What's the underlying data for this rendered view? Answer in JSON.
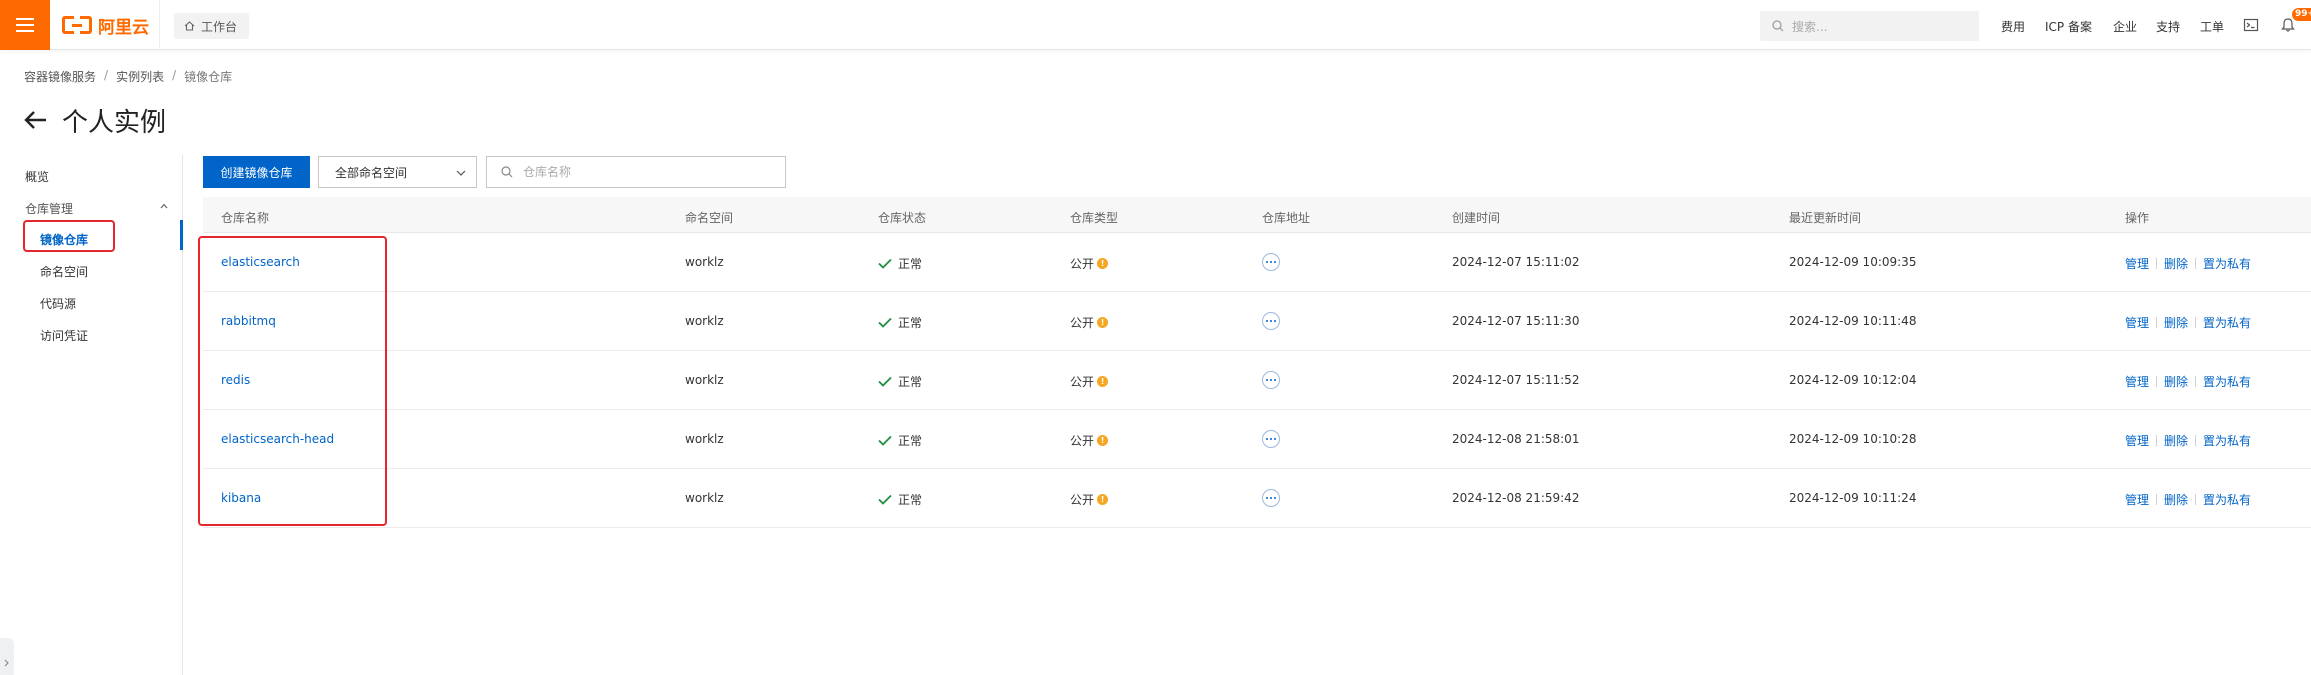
{
  "header": {
    "logo_text": "阿里云",
    "workbench_label": "工作台",
    "search_placeholder": "搜索...",
    "nav": [
      "费用",
      "ICP 备案",
      "企业",
      "支持",
      "工单"
    ],
    "notification_count": "99+",
    "brand_color": "#ff6a00"
  },
  "breadcrumb": [
    "容器镜像服务",
    "实例列表",
    "镜像仓库"
  ],
  "page_title": "个人实例",
  "sidebar": {
    "overview": "概览",
    "group_label": "仓库管理",
    "items": [
      "镜像仓库",
      "命名空间",
      "代码源",
      "访问凭证"
    ],
    "active_item": "镜像仓库"
  },
  "toolbar": {
    "create_label": "创建镜像仓库",
    "namespace_select": "全部命名空间",
    "search_placeholder": "仓库名称"
  },
  "table": {
    "columns": [
      "仓库名称",
      "命名空间",
      "仓库状态",
      "仓库类型",
      "仓库地址",
      "创建时间",
      "最近更新时间",
      "操作"
    ],
    "rows": [
      {
        "name": "elasticsearch",
        "namespace": "worklz",
        "status": "正常",
        "type": "公开",
        "created": "2024-12-07 15:11:02",
        "updated": "2024-12-09 10:09:35"
      },
      {
        "name": "rabbitmq",
        "namespace": "worklz",
        "status": "正常",
        "type": "公开",
        "created": "2024-12-07 15:11:30",
        "updated": "2024-12-09 10:11:48"
      },
      {
        "name": "redis",
        "namespace": "worklz",
        "status": "正常",
        "type": "公开",
        "created": "2024-12-07 15:11:52",
        "updated": "2024-12-09 10:12:04"
      },
      {
        "name": "elasticsearch-head",
        "namespace": "worklz",
        "status": "正常",
        "type": "公开",
        "created": "2024-12-08 21:58:01",
        "updated": "2024-12-09 10:10:28"
      },
      {
        "name": "kibana",
        "namespace": "worklz",
        "status": "正常",
        "type": "公开",
        "created": "2024-12-08 21:59:42",
        "updated": "2024-12-09 10:11:24"
      }
    ],
    "actions": [
      "管理",
      "删除",
      "置为私有"
    ]
  },
  "colors": {
    "primary": "#0064c8",
    "success": "#1e8e3e",
    "warning": "#f5a623",
    "highlight": "#e5262c"
  }
}
